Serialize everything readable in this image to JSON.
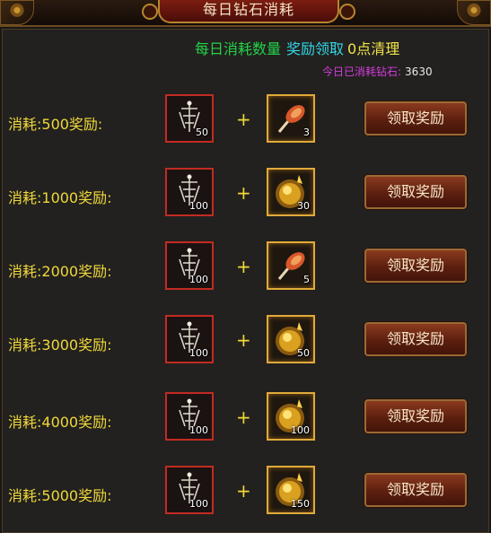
{
  "window": {
    "title": "每日钻石消耗"
  },
  "header": {
    "daily_count_label": "每日消耗数量",
    "reward_claim_label": "奖励领取",
    "reset_label": "0点清理"
  },
  "today": {
    "label": "今日已消耗钻石:",
    "value": "3630"
  },
  "rows": [
    {
      "label": "消耗:500奖励:",
      "item1_icon": "bone-claw-icon",
      "item1_count": "50",
      "item2_icon": "roasted-meat-icon",
      "item2_count": "3",
      "button": "领取奖励"
    },
    {
      "label": "消耗:1000奖励:",
      "item1_icon": "bone-claw-icon",
      "item1_count": "100",
      "item2_icon": "golden-orb-icon",
      "item2_count": "30",
      "button": "领取奖励"
    },
    {
      "label": "消耗:2000奖励:",
      "item1_icon": "bone-claw-icon",
      "item1_count": "100",
      "item2_icon": "roasted-meat-icon",
      "item2_count": "5",
      "button": "领取奖励"
    },
    {
      "label": "消耗:3000奖励:",
      "item1_icon": "bone-claw-icon",
      "item1_count": "100",
      "item2_icon": "golden-orb-icon",
      "item2_count": "50",
      "button": "领取奖励"
    },
    {
      "label": "消耗:4000奖励:",
      "item1_icon": "bone-claw-icon",
      "item1_count": "100",
      "item2_icon": "golden-orb-icon",
      "item2_count": "100",
      "button": "领取奖励"
    },
    {
      "label": "消耗:5000奖励:",
      "item1_icon": "bone-claw-icon",
      "item1_count": "100",
      "item2_icon": "golden-orb-icon",
      "item2_count": "150",
      "button": "领取奖励"
    }
  ],
  "plus_symbol": "+",
  "colors": {
    "label_yellow": "#f0d83a",
    "green": "#25d14a",
    "cyan": "#32d6e6",
    "magenta": "#d83be0",
    "red_border": "#c22b22",
    "gold_border": "#e0aa3a"
  }
}
